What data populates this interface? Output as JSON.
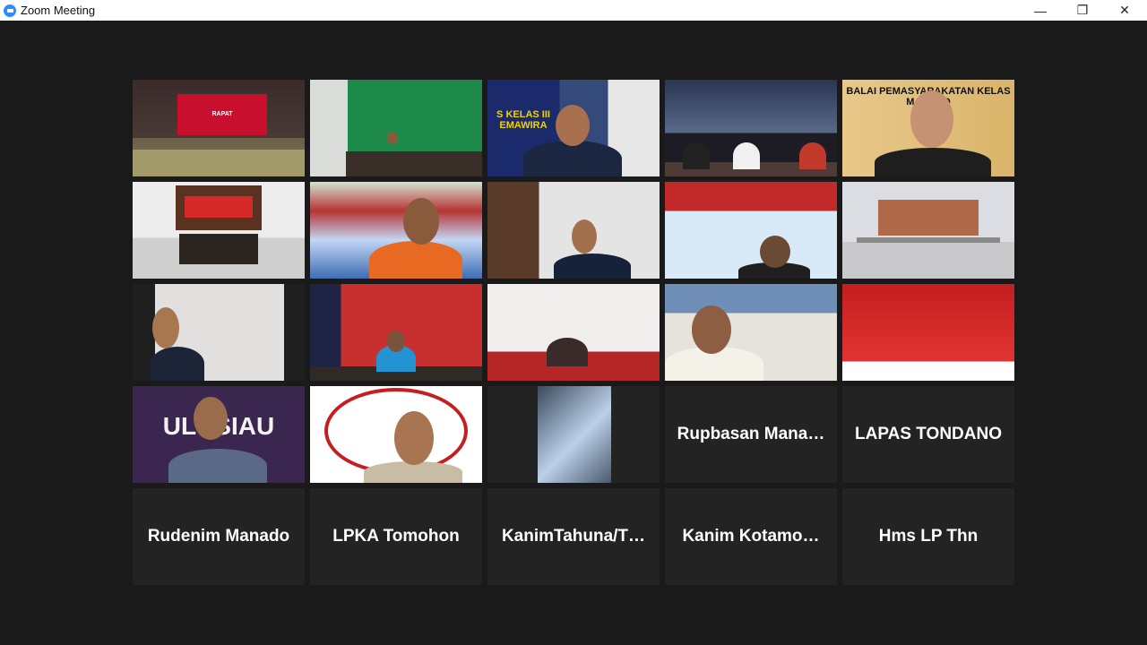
{
  "window": {
    "title": "Zoom Meeting",
    "minimize": "—",
    "restore": "❐",
    "close": "✕"
  },
  "tiles": [
    {
      "label": "RAPAT"
    },
    {
      "label": ""
    },
    {
      "label": "S KELAS III EMAWIRA"
    },
    {
      "label": ""
    },
    {
      "label": "BALAI PEMASYARAKATAN KELAS MANADO"
    },
    {
      "label": ""
    },
    {
      "label": ""
    },
    {
      "label": ""
    },
    {
      "label": ""
    },
    {
      "label": ""
    },
    {
      "label": ""
    },
    {
      "label": ""
    },
    {
      "label": ""
    },
    {
      "label": ""
    },
    {
      "label": ""
    },
    {
      "label": "ULUSIAU"
    },
    {
      "label": ""
    },
    {
      "label": ""
    },
    {
      "label": "Rupbasan  Mana…"
    },
    {
      "label": "LAPAS TONDANO"
    },
    {
      "label": "Rudenim Manado"
    },
    {
      "label": "LPKA Tomohon"
    },
    {
      "label": "KanimTahuna/T…"
    },
    {
      "label": "Kanim  Kotamo…"
    },
    {
      "label": "Hms LP Thn"
    }
  ]
}
